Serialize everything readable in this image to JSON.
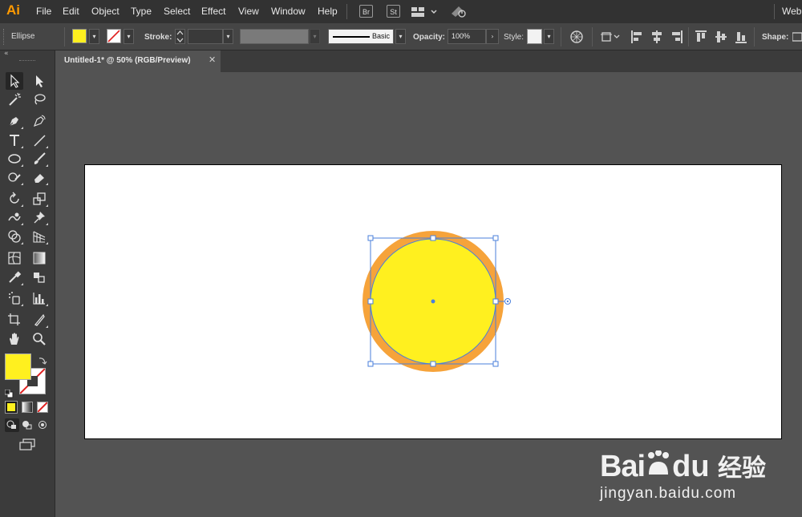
{
  "app": {
    "logo": "Ai"
  },
  "menu": {
    "items": [
      "File",
      "Edit",
      "Object",
      "Type",
      "Select",
      "Effect",
      "View",
      "Window",
      "Help"
    ],
    "bridge": "Br",
    "stock": "St",
    "workspace": "Web"
  },
  "control": {
    "selection_type": "Ellipse",
    "stroke_label": "Stroke:",
    "brush_label": "Basic",
    "opacity_label": "Opacity:",
    "opacity_value": "100%",
    "style_label": "Style:",
    "shape_label": "Shape:"
  },
  "document": {
    "tab_title": "Untitled-1* @ 50% (RGB/Preview)"
  },
  "colors": {
    "fill": "#FFF01F",
    "stroke": "#F6A33A",
    "selection": "#4A7FDB",
    "accent": "#FF9A00"
  },
  "watermark": {
    "brand": "Bai",
    "brand2": "du",
    "cn": "经验",
    "url": "jingyan.baidu.com"
  }
}
